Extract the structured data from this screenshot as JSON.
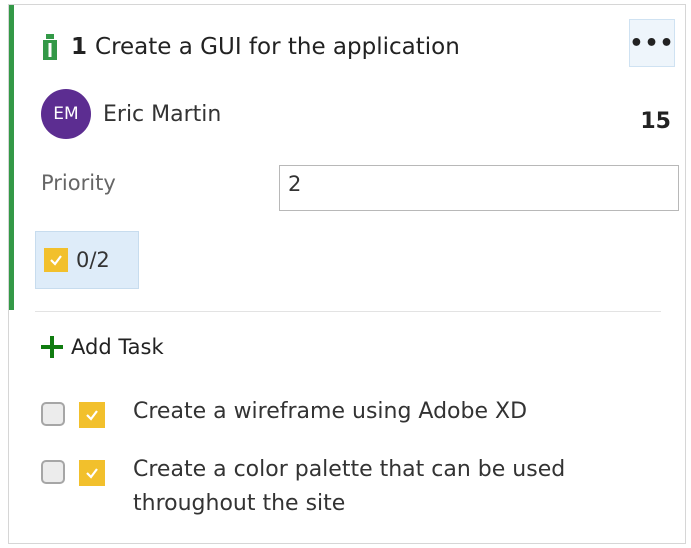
{
  "work_item": {
    "id": "1",
    "title": "Create a GUI for the application",
    "more_label": "•••",
    "assignee": {
      "initials": "EM",
      "name": "Eric Martin"
    },
    "effort": "15",
    "priority_label": "Priority",
    "priority_value": "2",
    "task_progress": "0/2",
    "colors": {
      "accent": "#339947",
      "task_yellow": "#f2c02c",
      "avatar": "#5c2d91"
    }
  },
  "tasks_section": {
    "add_task_label": "Add Task",
    "tasks": [
      {
        "title": "Create a wireframe using Adobe XD"
      },
      {
        "title": "Create a color palette that can be used throughout the site"
      }
    ]
  }
}
